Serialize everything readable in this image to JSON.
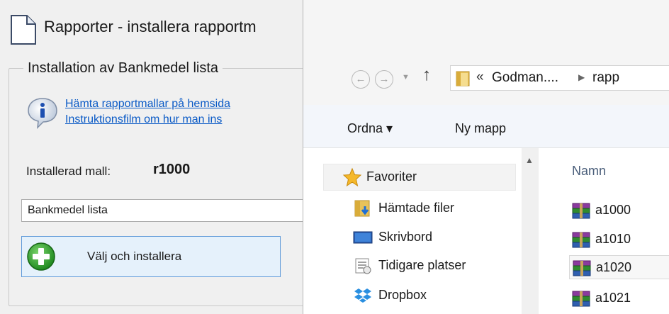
{
  "left_window": {
    "title": "Rapporter - installera rapportm",
    "group_title": "Installation av Bankmedel lista",
    "link_download": "Hämta rapportmallar på hemsida",
    "link_video": "Instruktionsfilm om hur man ins",
    "installed_label": "Installerad mall:",
    "installed_value": "r1000",
    "report_name_value": "Bankmedel lista",
    "install_button_label": "Välj och installera"
  },
  "file_dialog": {
    "address_segments": [
      "Godman....",
      "rapp"
    ],
    "toolbar": {
      "organize_label": "Ordna ▾",
      "new_folder_label": "Ny mapp"
    },
    "nav_items": [
      {
        "label": "Favoriter",
        "icon": "star-icon"
      },
      {
        "label": "Hämtade filer",
        "icon": "downloads-folder-icon"
      },
      {
        "label": "Skrivbord",
        "icon": "desktop-icon"
      },
      {
        "label": "Tidigare platser",
        "icon": "recent-places-icon"
      },
      {
        "label": "Dropbox",
        "icon": "dropbox-icon"
      }
    ],
    "column_name": "Namn",
    "files": [
      {
        "name": "a1000",
        "icon": "archive-icon"
      },
      {
        "name": "a1010",
        "icon": "archive-icon"
      },
      {
        "name": "a1020",
        "icon": "archive-icon",
        "selected": true
      },
      {
        "name": "a1021",
        "icon": "archive-icon"
      }
    ]
  },
  "colors": {
    "link": "#0a5ac6",
    "button_border": "#5f9ad9",
    "button_bg": "#e5f1fb",
    "column_header": "#4a5e7a",
    "install_icon_green": "#2ea02e"
  }
}
